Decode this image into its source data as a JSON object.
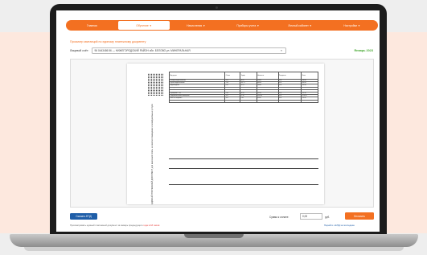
{
  "nav": {
    "items": [
      {
        "label": "Главная",
        "active": false,
        "has_caret": false
      },
      {
        "label": "Обучение",
        "active": true,
        "has_caret": true
      },
      {
        "label": "Начисления",
        "active": false,
        "has_caret": true
      },
      {
        "label": "Приборы учета",
        "active": false,
        "has_caret": true
      },
      {
        "label": "Личный кабинет",
        "active": false,
        "has_caret": true
      },
      {
        "label": "Настройки",
        "active": false,
        "has_caret": true
      }
    ]
  },
  "page": {
    "title": "Просмотр квитанций по единому платежному документу",
    "account_label": "Лицевой счёт:",
    "account_value": "96 0443486 56  — НИЖЕГОРОДСКИЙ РАЙОН обл. БЕЛОВО ул. МИНЕРАЛЬНАЯ",
    "period": "Январь 2023"
  },
  "document": {
    "vertical_text": "ЕДИНЫЙ ПЛАТЕЖНЫЙ ДОКУМЕНТ для внесения платы за жилое помещение и коммунальные услуги",
    "table_rows": [
      [
        "Вид услуги",
        "Объем",
        "Тариф",
        "Начислено",
        "Перерасчет",
        "Итого"
      ],
      [
        "Холодное водоснабжение",
        "4.12",
        "38.47",
        "158.50",
        "0.00",
        "158.50"
      ],
      [
        "Горячее водоснабжение",
        "2.30",
        "167.21",
        "384.58",
        "0.00",
        "384.58"
      ],
      [
        "Водоотведение",
        "6.42",
        "28.79",
        "184.83",
        "0.00",
        "184.83"
      ],
      [
        "Электроснабжение",
        "120",
        "5.37",
        "644.40",
        "0.00",
        "644.40"
      ],
      [
        "Отопление",
        "1.45",
        "2104.11",
        "3050.96",
        "0.00",
        "3050.96"
      ],
      [
        "Обращение с ТКО",
        "2.00",
        "96.15",
        "192.30",
        "0.00",
        "192.30"
      ],
      [
        "Содержание жилого помещения",
        "54.2",
        "21.30",
        "1154.46",
        "0.00",
        "1154.46"
      ],
      [
        "Взнос на капремонт",
        "54.2",
        "9.85",
        "533.87",
        "0.00",
        "533.87"
      ],
      [
        "Итого к оплате",
        "",
        "",
        "6303.90",
        "0.00",
        "6303.90"
      ]
    ]
  },
  "footer": {
    "download_label": "Скачать ЕПД",
    "pay_label": "Сумма к оплате:",
    "pay_value": "0,00",
    "pay_unit": "руб.",
    "pay_button": "Оплатить",
    "note_text": "Просматривать единый платежный документ за январь предыдущего",
    "note_warn": "года в 18 часов",
    "archive_link": "Перейти к ЕПД за последние"
  },
  "colors": {
    "accent": "#f37021",
    "primary_button": "#1f5ea8",
    "period": "#46a832"
  }
}
